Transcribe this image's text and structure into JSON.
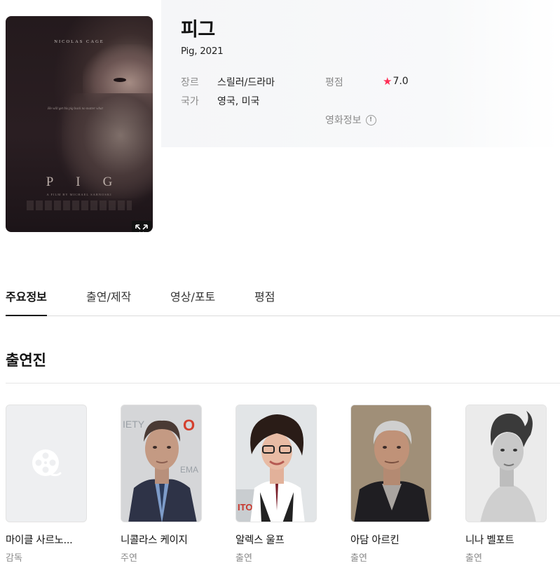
{
  "movie": {
    "title": "피그",
    "original_title_year": "Pig, 2021",
    "poster": {
      "actor_name": "NICOLAS CAGE",
      "tagline": "He will get his pig back no matter what",
      "title": "PIG",
      "credit": "A FILM BY MICHAEL SARNOSKI"
    },
    "meta": {
      "genre_label": "장르",
      "genre_value": "스릴러/드라마",
      "country_label": "국가",
      "country_value": "영국, 미국",
      "rating_label": "평점",
      "rating_value": "7.0",
      "info_link": "영화정보",
      "info_icon": "!"
    }
  },
  "tabs": [
    {
      "label": "주요정보",
      "active": true
    },
    {
      "label": "출연/제작",
      "active": false
    },
    {
      "label": "영상/포토",
      "active": false
    },
    {
      "label": "평점",
      "active": false
    }
  ],
  "cast_section": {
    "title": "출연진",
    "members": [
      {
        "name": "마이클 사르노...",
        "role": "감독",
        "photo": "placeholder-film-reel-icon"
      },
      {
        "name": "니콜라스 케이지",
        "role": "주연",
        "photo": "portrait"
      },
      {
        "name": "알렉스 울프",
        "role": "출연",
        "photo": "portrait"
      },
      {
        "name": "아담 아르킨",
        "role": "출연",
        "photo": "portrait"
      },
      {
        "name": "니나 벨포트",
        "role": "출연",
        "photo": "portrait"
      }
    ]
  },
  "colors": {
    "accent_star": "#ff2d55",
    "text_primary": "#111111",
    "text_secondary": "#8a8a8a",
    "header_bg": "#f6f7f9"
  },
  "icons": {
    "expand": "expand-arrows-icon",
    "star": "star-icon",
    "info": "info-circle-icon",
    "placeholder": "film-reel-icon"
  }
}
